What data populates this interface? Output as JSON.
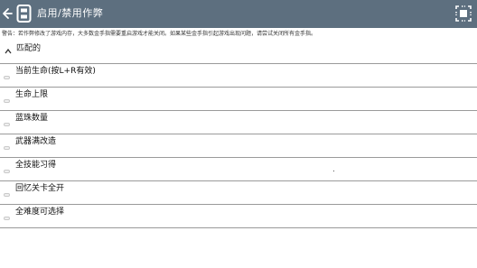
{
  "header": {
    "title": "启用/禁用作弊",
    "back_icon": "arrow-left-icon",
    "app_icon": "cheat-app-icon",
    "menu_icon": "select-frame-icon"
  },
  "warning": "警告：若作弊修改了游戏内存，大多数金手指需要重启游戏才能关闭。如果某些金手指引起游戏出现问题，请尝试关闭所有金手指。",
  "group": {
    "label": "匹配的",
    "caret_icon": "caret-up-icon"
  },
  "cheats": [
    {
      "label": "当前生命(按L+R有效)",
      "enabled": false
    },
    {
      "label": "生命上限",
      "enabled": false
    },
    {
      "label": "蓝珠数量",
      "enabled": false
    },
    {
      "label": "武器满改造",
      "enabled": false
    },
    {
      "label": "全技能习得",
      "enabled": false
    },
    {
      "label": "回忆关卡全开",
      "enabled": false
    },
    {
      "label": "全难度可选择",
      "enabled": false
    }
  ],
  "colors": {
    "header_bg": "#5d6f7f",
    "header_text": "#ffffff",
    "divider": "#9a9a9a"
  }
}
